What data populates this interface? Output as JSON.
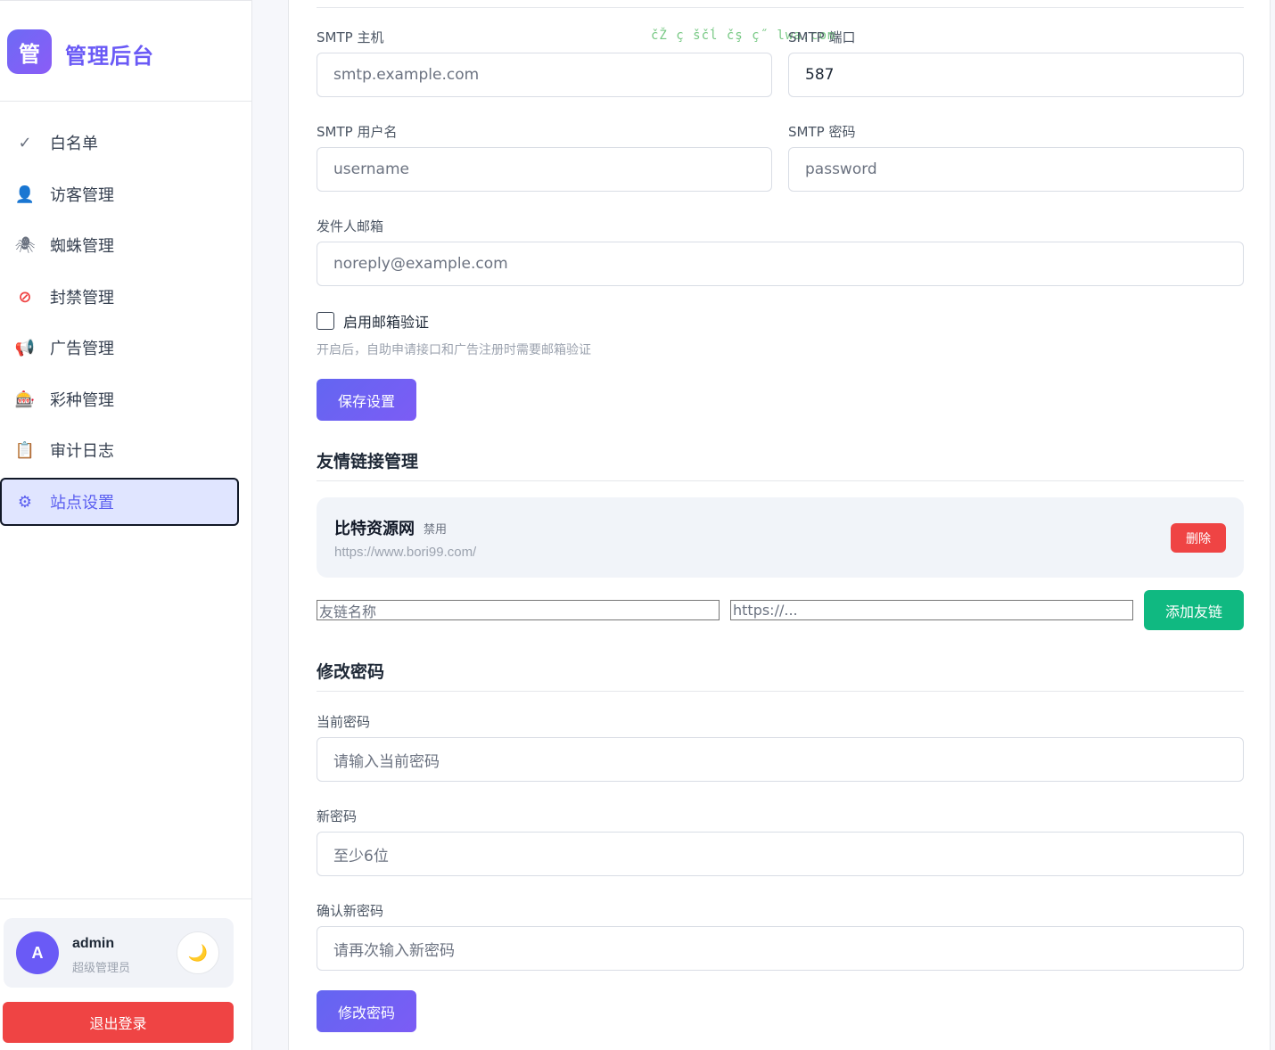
{
  "brand": {
    "logo_char": "管",
    "title": "管理后台"
  },
  "sidebar": {
    "items": [
      {
        "icon": "check-icon",
        "glyph": "✓",
        "label": "白名单",
        "color": "#6b7280"
      },
      {
        "icon": "user-icon",
        "glyph": "👤",
        "label": "访客管理",
        "color": "#4b2e83"
      },
      {
        "icon": "spider-icon",
        "glyph": "🕷",
        "label": "蜘蛛管理",
        "color": "#6b7280"
      },
      {
        "icon": "ban-icon",
        "glyph": "⊘",
        "label": "封禁管理",
        "color": "#ef4444"
      },
      {
        "icon": "megaphone-icon",
        "glyph": "📢",
        "label": "广告管理",
        "color": "#ef4444"
      },
      {
        "icon": "slot-machine-icon",
        "glyph": "🎰",
        "label": "彩种管理",
        "color": "#6b7280"
      },
      {
        "icon": "clipboard-icon",
        "glyph": "📋",
        "label": "审计日志",
        "color": "#c8884a"
      },
      {
        "icon": "gear-icon",
        "glyph": "⚙",
        "label": "站点设置",
        "color": "#5b5ff0"
      }
    ],
    "active_index": 7
  },
  "user": {
    "avatar_char": "A",
    "name": "admin",
    "role": "超级管理员",
    "theme_glyph": "🌙"
  },
  "logout_label": "退出登录",
  "watermark": "čŽ ç ščĺ čş ç˝ lwa.com",
  "smtp": {
    "host_label": "SMTP 主机",
    "host_placeholder": "smtp.example.com",
    "port_label": "SMTP 端口",
    "port_value": "587",
    "user_label": "SMTP 用户名",
    "user_placeholder": "username",
    "pass_label": "SMTP 密码",
    "pass_placeholder": "password",
    "sender_label": "发件人邮箱",
    "sender_placeholder": "noreply@example.com",
    "verify_checkbox_label": "启用邮箱验证",
    "verify_checked": false,
    "verify_hint": "开启后，自助申请接口和广告注册时需要邮箱验证",
    "save_label": "保存设置"
  },
  "friend_links": {
    "title": "友情链接管理",
    "items": [
      {
        "name": "比特资源网",
        "status": "禁用",
        "url": "https://www.bori99.com/",
        "delete_label": "删除"
      }
    ],
    "name_placeholder": "友链名称",
    "url_placeholder": "https://...",
    "add_label": "添加友链"
  },
  "password": {
    "title": "修改密码",
    "current_label": "当前密码",
    "current_placeholder": "请输入当前密码",
    "new_label": "新密码",
    "new_placeholder": "至少6位",
    "confirm_label": "确认新密码",
    "confirm_placeholder": "请再次输入新密码",
    "submit_label": "修改密码"
  }
}
